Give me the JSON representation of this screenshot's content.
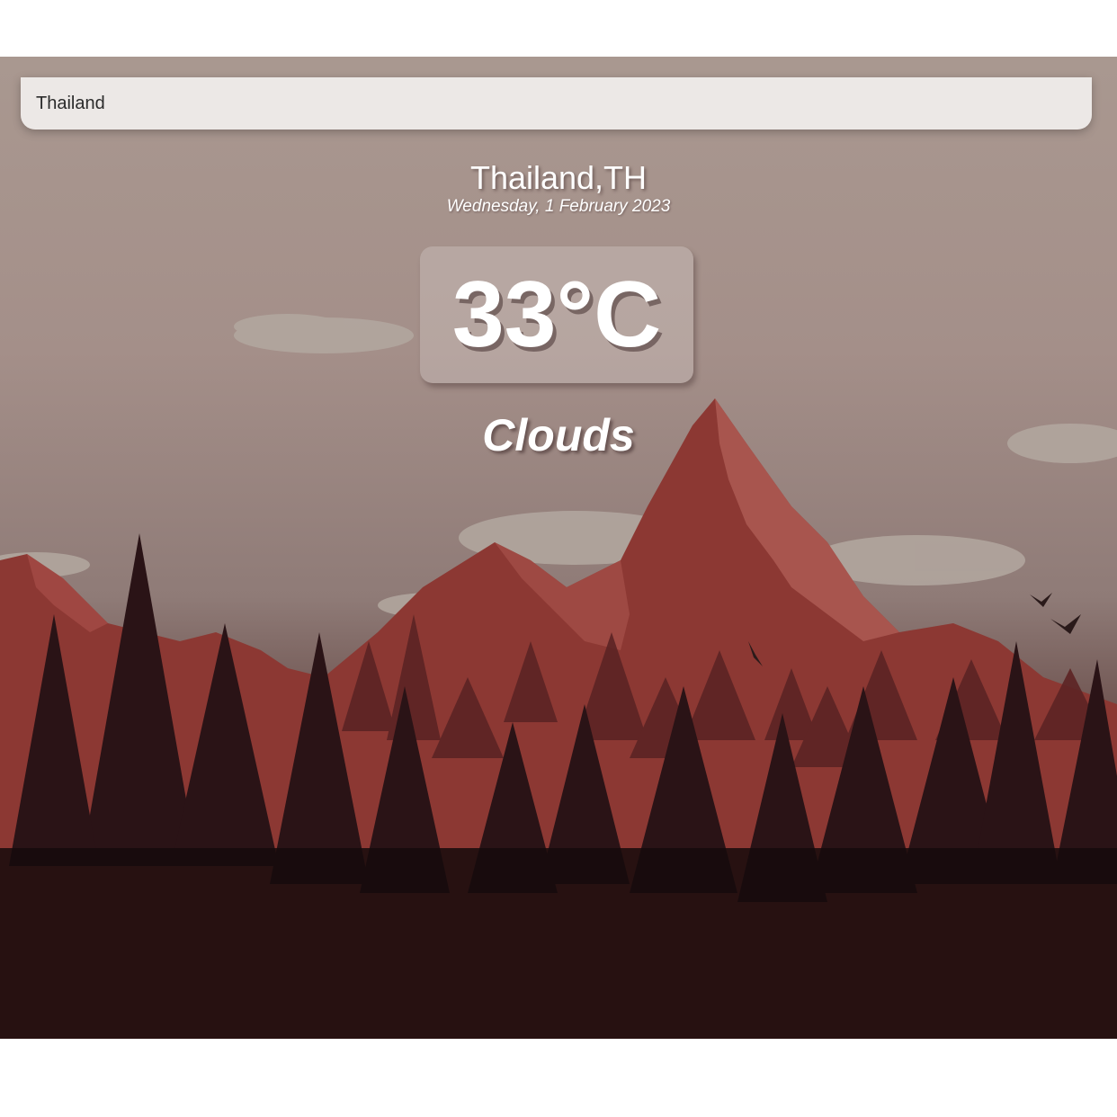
{
  "search": {
    "value": "Thailand"
  },
  "location": {
    "name": "Thailand,TH",
    "date": "Wednesday, 1 February 2023"
  },
  "weather": {
    "temperature": "33°C",
    "condition": "Clouds"
  },
  "colors": {
    "sky_top": "#a99890",
    "mountain": "#8c3833",
    "mountain_highlight": "#b05c55",
    "forest_dark": "#1c0e10",
    "text": "#ffffff"
  }
}
